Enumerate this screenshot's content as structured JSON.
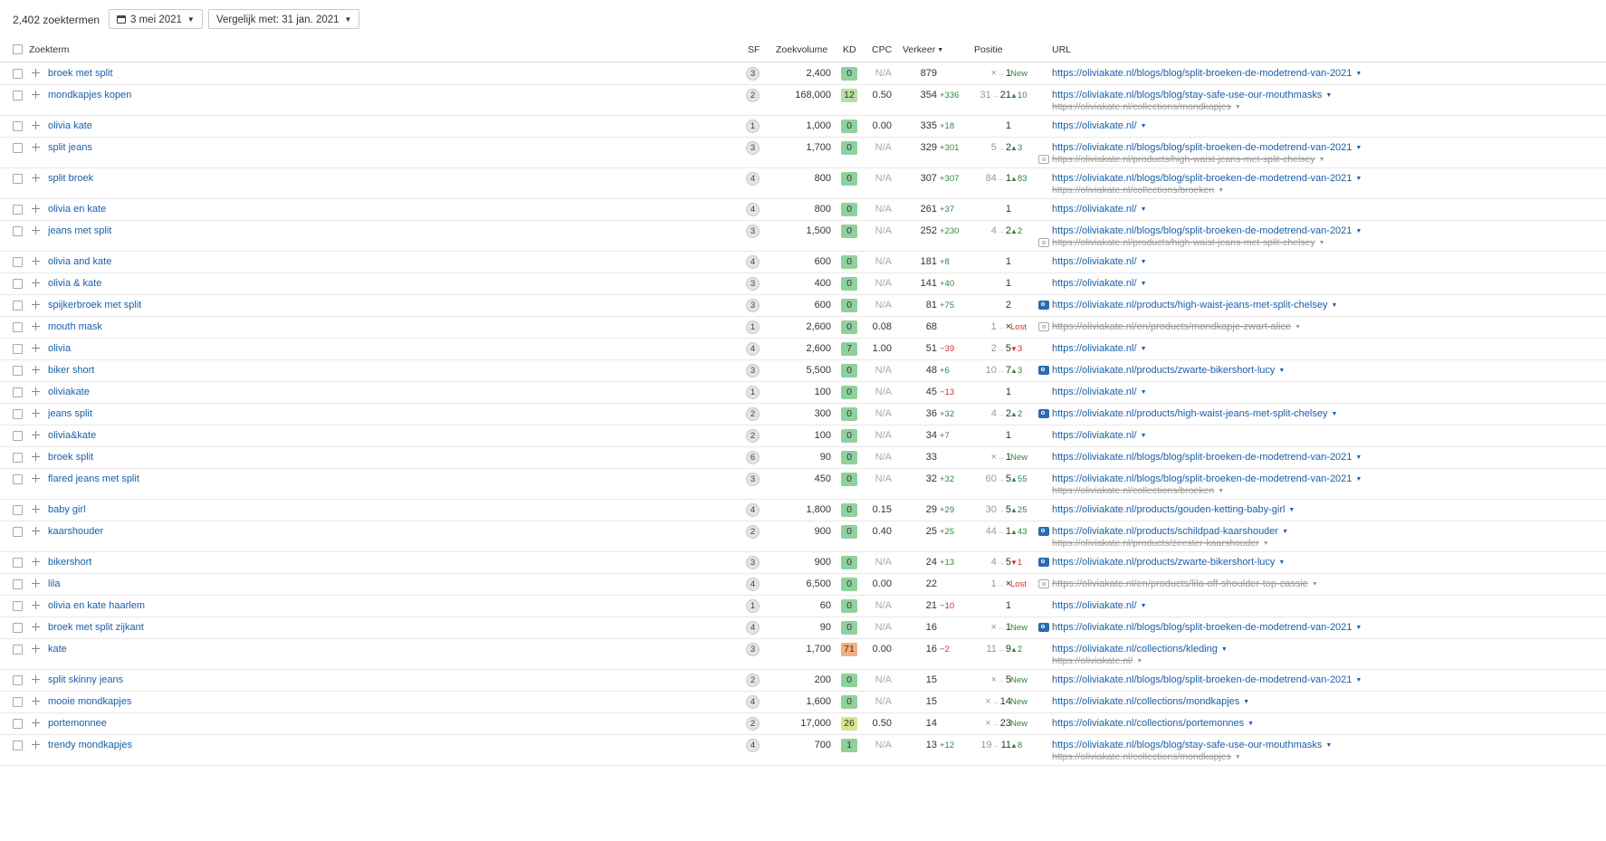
{
  "toolbar": {
    "keyword_count": "2,402 zoektermen",
    "date": "3 mei 2021",
    "compare": "Vergelijk met: 31 jan. 2021"
  },
  "columns": {
    "keyword": "Zoekterm",
    "sf": "SF",
    "volume": "Zoekvolume",
    "kd": "KD",
    "cpc": "CPC",
    "traffic": "Verkeer",
    "position": "Positie",
    "url": "URL"
  },
  "colors": {
    "link": "#1a5fa8",
    "kd_green": "#8fd19e",
    "kd_lightgreen": "#b7df9e",
    "kd_yellowgreen": "#d6e68a",
    "kd_orange": "#f6ad80",
    "up": "#2b8a3e",
    "down": "#d0312d"
  },
  "rows": [
    {
      "kw": "broek met split",
      "sf": "3",
      "vol": "2,400",
      "kd": "0",
      "cpc": "N/A",
      "traffic": "879",
      "td": "",
      "old": "×",
      "new": "1",
      "pd": "New",
      "url": "https://oliviakate.nl/blogs/blog/split-broeken-de-modetrend-van-2021",
      "icon": "",
      "url2": "",
      "icon2": ""
    },
    {
      "kw": "mondkapjes kopen",
      "sf": "2",
      "vol": "168,000",
      "kd": "12",
      "cpc": "0.50",
      "traffic": "354",
      "td": "+336",
      "old": "31",
      "new": "21",
      "pd": "10",
      "url": "https://oliviakate.nl/blogs/blog/stay-safe-use-our-mouthmasks",
      "icon": "",
      "url2": "https://oliviakate.nl/collections/mondkapjes",
      "icon2": ""
    },
    {
      "kw": "olivia kate",
      "sf": "1",
      "vol": "1,000",
      "kd": "0",
      "cpc": "0.00",
      "traffic": "335",
      "td": "+18",
      "old": "",
      "new": "1",
      "pd": "",
      "url": "https://oliviakate.nl/",
      "icon": "",
      "url2": "",
      "icon2": ""
    },
    {
      "kw": "split jeans",
      "sf": "3",
      "vol": "1,700",
      "kd": "0",
      "cpc": "N/A",
      "traffic": "329",
      "td": "+301",
      "old": "5",
      "new": "2",
      "pd": "3",
      "url": "https://oliviakate.nl/blogs/blog/split-broeken-de-modetrend-van-2021",
      "icon": "",
      "url2": "https://oliviakate.nl/products/high-waist-jeans-met-split-chelsey",
      "icon2": "gray"
    },
    {
      "kw": "split broek",
      "sf": "4",
      "vol": "800",
      "kd": "0",
      "cpc": "N/A",
      "traffic": "307",
      "td": "+307",
      "old": "84",
      "new": "1",
      "pd": "83",
      "url": "https://oliviakate.nl/blogs/blog/split-broeken-de-modetrend-van-2021",
      "icon": "",
      "url2": "https://oliviakate.nl/collections/broeken",
      "icon2": ""
    },
    {
      "kw": "olivia en kate",
      "sf": "4",
      "vol": "800",
      "kd": "0",
      "cpc": "N/A",
      "traffic": "261",
      "td": "+37",
      "old": "",
      "new": "1",
      "pd": "",
      "url": "https://oliviakate.nl/",
      "icon": "",
      "url2": "",
      "icon2": ""
    },
    {
      "kw": "jeans met split",
      "sf": "3",
      "vol": "1,500",
      "kd": "0",
      "cpc": "N/A",
      "traffic": "252",
      "td": "+230",
      "old": "4",
      "new": "2",
      "pd": "2",
      "url": "https://oliviakate.nl/blogs/blog/split-broeken-de-modetrend-van-2021",
      "icon": "",
      "url2": "https://oliviakate.nl/products/high-waist-jeans-met-split-chelsey",
      "icon2": "gray"
    },
    {
      "kw": "olivia and kate",
      "sf": "4",
      "vol": "600",
      "kd": "0",
      "cpc": "N/A",
      "traffic": "181",
      "td": "+8",
      "old": "",
      "new": "1",
      "pd": "",
      "url": "https://oliviakate.nl/",
      "icon": "",
      "url2": "",
      "icon2": ""
    },
    {
      "kw": "olivia & kate",
      "sf": "3",
      "vol": "400",
      "kd": "0",
      "cpc": "N/A",
      "traffic": "141",
      "td": "+40",
      "old": "",
      "new": "1",
      "pd": "",
      "url": "https://oliviakate.nl/",
      "icon": "",
      "url2": "",
      "icon2": ""
    },
    {
      "kw": "spijkerbroek met split",
      "sf": "3",
      "vol": "600",
      "kd": "0",
      "cpc": "N/A",
      "traffic": "81",
      "td": "+75",
      "old": "",
      "new": "2",
      "pd": "",
      "url": "https://oliviakate.nl/products/high-waist-jeans-met-split-chelsey",
      "icon": "blue",
      "url2": "",
      "icon2": ""
    },
    {
      "kw": "mouth mask",
      "sf": "1",
      "vol": "2,600",
      "kd": "0",
      "cpc": "0.08",
      "traffic": "68",
      "td": "",
      "old": "1",
      "new": "×",
      "pd": "Lost",
      "url": "https://oliviakate.nl/en/products/mondkapje-zwart-alice",
      "icon": "gray",
      "url2": "",
      "icon2": ""
    },
    {
      "kw": "olivia",
      "sf": "4",
      "vol": "2,600",
      "kd": "7",
      "cpc": "1.00",
      "traffic": "51",
      "td": "−39",
      "old": "2",
      "new": "5",
      "pd": "3",
      "url": "https://oliviakate.nl/",
      "icon": "",
      "url2": "",
      "icon2": ""
    },
    {
      "kw": "biker short",
      "sf": "3",
      "vol": "5,500",
      "kd": "0",
      "cpc": "N/A",
      "traffic": "48",
      "td": "+6",
      "old": "10",
      "new": "7",
      "pd": "3",
      "url": "https://oliviakate.nl/products/zwarte-bikershort-lucy",
      "icon": "blue",
      "url2": "",
      "icon2": ""
    },
    {
      "kw": "oliviakate",
      "sf": "1",
      "vol": "100",
      "kd": "0",
      "cpc": "N/A",
      "traffic": "45",
      "td": "−13",
      "old": "",
      "new": "1",
      "pd": "",
      "url": "https://oliviakate.nl/",
      "icon": "",
      "url2": "",
      "icon2": ""
    },
    {
      "kw": "jeans split",
      "sf": "2",
      "vol": "300",
      "kd": "0",
      "cpc": "N/A",
      "traffic": "36",
      "td": "+32",
      "old": "4",
      "new": "2",
      "pd": "2",
      "url": "https://oliviakate.nl/products/high-waist-jeans-met-split-chelsey",
      "icon": "blue",
      "url2": "",
      "icon2": ""
    },
    {
      "kw": "olivia&kate",
      "sf": "2",
      "vol": "100",
      "kd": "0",
      "cpc": "N/A",
      "traffic": "34",
      "td": "+7",
      "old": "",
      "new": "1",
      "pd": "",
      "url": "https://oliviakate.nl/",
      "icon": "",
      "url2": "",
      "icon2": ""
    },
    {
      "kw": "broek split",
      "sf": "6",
      "vol": "90",
      "kd": "0",
      "cpc": "N/A",
      "traffic": "33",
      "td": "",
      "old": "×",
      "new": "1",
      "pd": "New",
      "url": "https://oliviakate.nl/blogs/blog/split-broeken-de-modetrend-van-2021",
      "icon": "",
      "url2": "",
      "icon2": ""
    },
    {
      "kw": "flared jeans met split",
      "sf": "3",
      "vol": "450",
      "kd": "0",
      "cpc": "N/A",
      "traffic": "32",
      "td": "+32",
      "old": "60",
      "new": "5",
      "pd": "55",
      "url": "https://oliviakate.nl/blogs/blog/split-broeken-de-modetrend-van-2021",
      "icon": "",
      "url2": "https://oliviakate.nl/collections/broeken",
      "icon2": ""
    },
    {
      "kw": "baby girl",
      "sf": "4",
      "vol": "1,800",
      "kd": "0",
      "cpc": "0.15",
      "traffic": "29",
      "td": "+29",
      "old": "30",
      "new": "5",
      "pd": "25",
      "url": "https://oliviakate.nl/products/gouden-ketting-baby-girl",
      "icon": "",
      "url2": "",
      "icon2": ""
    },
    {
      "kw": "kaarshouder",
      "sf": "2",
      "vol": "900",
      "kd": "0",
      "cpc": "0.40",
      "traffic": "25",
      "td": "+25",
      "old": "44",
      "new": "1",
      "pd": "43",
      "url": "https://oliviakate.nl/products/schildpad-kaarshouder",
      "icon": "blue",
      "url2": "https://oliviakate.nl/products/zeester-kaarshouder",
      "icon2": ""
    },
    {
      "kw": "bikershort",
      "sf": "3",
      "vol": "900",
      "kd": "0",
      "cpc": "N/A",
      "traffic": "24",
      "td": "+13",
      "old": "4",
      "new": "5",
      "pd": "1",
      "url": "https://oliviakate.nl/products/zwarte-bikershort-lucy",
      "icon": "blue",
      "url2": "",
      "icon2": ""
    },
    {
      "kw": "lila",
      "sf": "4",
      "vol": "6,500",
      "kd": "0",
      "cpc": "0.00",
      "traffic": "22",
      "td": "",
      "old": "1",
      "new": "×",
      "pd": "Lost",
      "url": "https://oliviakate.nl/en/products/lila-off-shoulder-top-cassie",
      "icon": "gray",
      "url2": "",
      "icon2": ""
    },
    {
      "kw": "olivia en kate haarlem",
      "sf": "1",
      "vol": "60",
      "kd": "0",
      "cpc": "N/A",
      "traffic": "21",
      "td": "−10",
      "old": "",
      "new": "1",
      "pd": "",
      "url": "https://oliviakate.nl/",
      "icon": "",
      "url2": "",
      "icon2": ""
    },
    {
      "kw": "broek met split zijkant",
      "sf": "4",
      "vol": "90",
      "kd": "0",
      "cpc": "N/A",
      "traffic": "16",
      "td": "",
      "old": "×",
      "new": "1",
      "pd": "New",
      "url": "https://oliviakate.nl/blogs/blog/split-broeken-de-modetrend-van-2021",
      "icon": "blue",
      "url2": "",
      "icon2": ""
    },
    {
      "kw": "kate",
      "sf": "3",
      "vol": "1,700",
      "kd": "71",
      "cpc": "0.00",
      "traffic": "16",
      "td": "−2",
      "old": "11",
      "new": "9",
      "pd": "2",
      "url": "https://oliviakate.nl/collections/kleding",
      "icon": "",
      "url2": "https://oliviakate.nl/",
      "icon2": ""
    },
    {
      "kw": "split skinny jeans",
      "sf": "2",
      "vol": "200",
      "kd": "0",
      "cpc": "N/A",
      "traffic": "15",
      "td": "",
      "old": "×",
      "new": "5",
      "pd": "New",
      "url": "https://oliviakate.nl/blogs/blog/split-broeken-de-modetrend-van-2021",
      "icon": "",
      "url2": "",
      "icon2": ""
    },
    {
      "kw": "mooie mondkapjes",
      "sf": "4",
      "vol": "1,600",
      "kd": "0",
      "cpc": "N/A",
      "traffic": "15",
      "td": "",
      "old": "×",
      "new": "14",
      "pd": "New",
      "url": "https://oliviakate.nl/collections/mondkapjes",
      "icon": "",
      "url2": "",
      "icon2": ""
    },
    {
      "kw": "portemonnee",
      "sf": "2",
      "vol": "17,000",
      "kd": "26",
      "cpc": "0.50",
      "traffic": "14",
      "td": "",
      "old": "×",
      "new": "23",
      "pd": "New",
      "url": "https://oliviakate.nl/collections/portemonnes",
      "icon": "",
      "url2": "",
      "icon2": ""
    },
    {
      "kw": "trendy mondkapjes",
      "sf": "4",
      "vol": "700",
      "kd": "1",
      "cpc": "N/A",
      "traffic": "13",
      "td": "+12",
      "old": "19",
      "new": "11",
      "pd": "8",
      "url": "https://oliviakate.nl/blogs/blog/stay-safe-use-our-mouthmasks",
      "icon": "",
      "url2": "https://oliviakate.nl/collections/mondkapjes",
      "icon2": ""
    }
  ]
}
